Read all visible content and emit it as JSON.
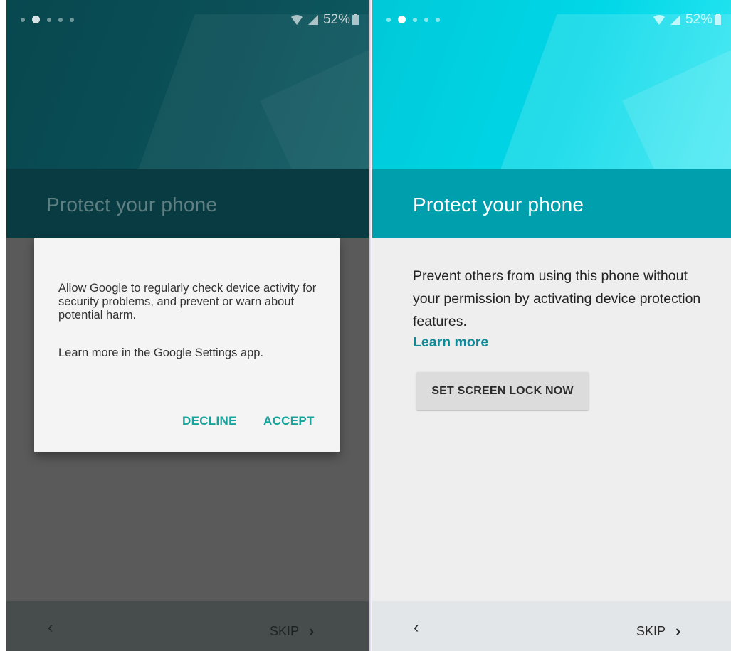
{
  "left_screen": {
    "status": {
      "battery": "52%"
    },
    "title": "Protect your phone",
    "dialog": {
      "message": "Allow Google to regularly check device activity for security problems, and prevent or warn about potential harm.",
      "learn_more": "Learn more in the Google Settings app.",
      "decline_label": "DECLINE",
      "accept_label": "ACCEPT"
    },
    "nav": {
      "back_label": "‹",
      "skip_label": "SKIP",
      "next_label": "›"
    }
  },
  "right_screen": {
    "status": {
      "battery": "52%"
    },
    "title": "Protect your phone",
    "description": "Prevent others from using this phone without your permission by activating device protection features.",
    "learn_more": "Learn more",
    "button_label": "SET SCREEN LOCK NOW",
    "nav": {
      "back_label": "‹",
      "skip_label": "SKIP",
      "next_label": "›"
    }
  },
  "colors": {
    "accent_teal": "#009fad",
    "dialog_button": "#17a39b",
    "link": "#0f8a96"
  }
}
